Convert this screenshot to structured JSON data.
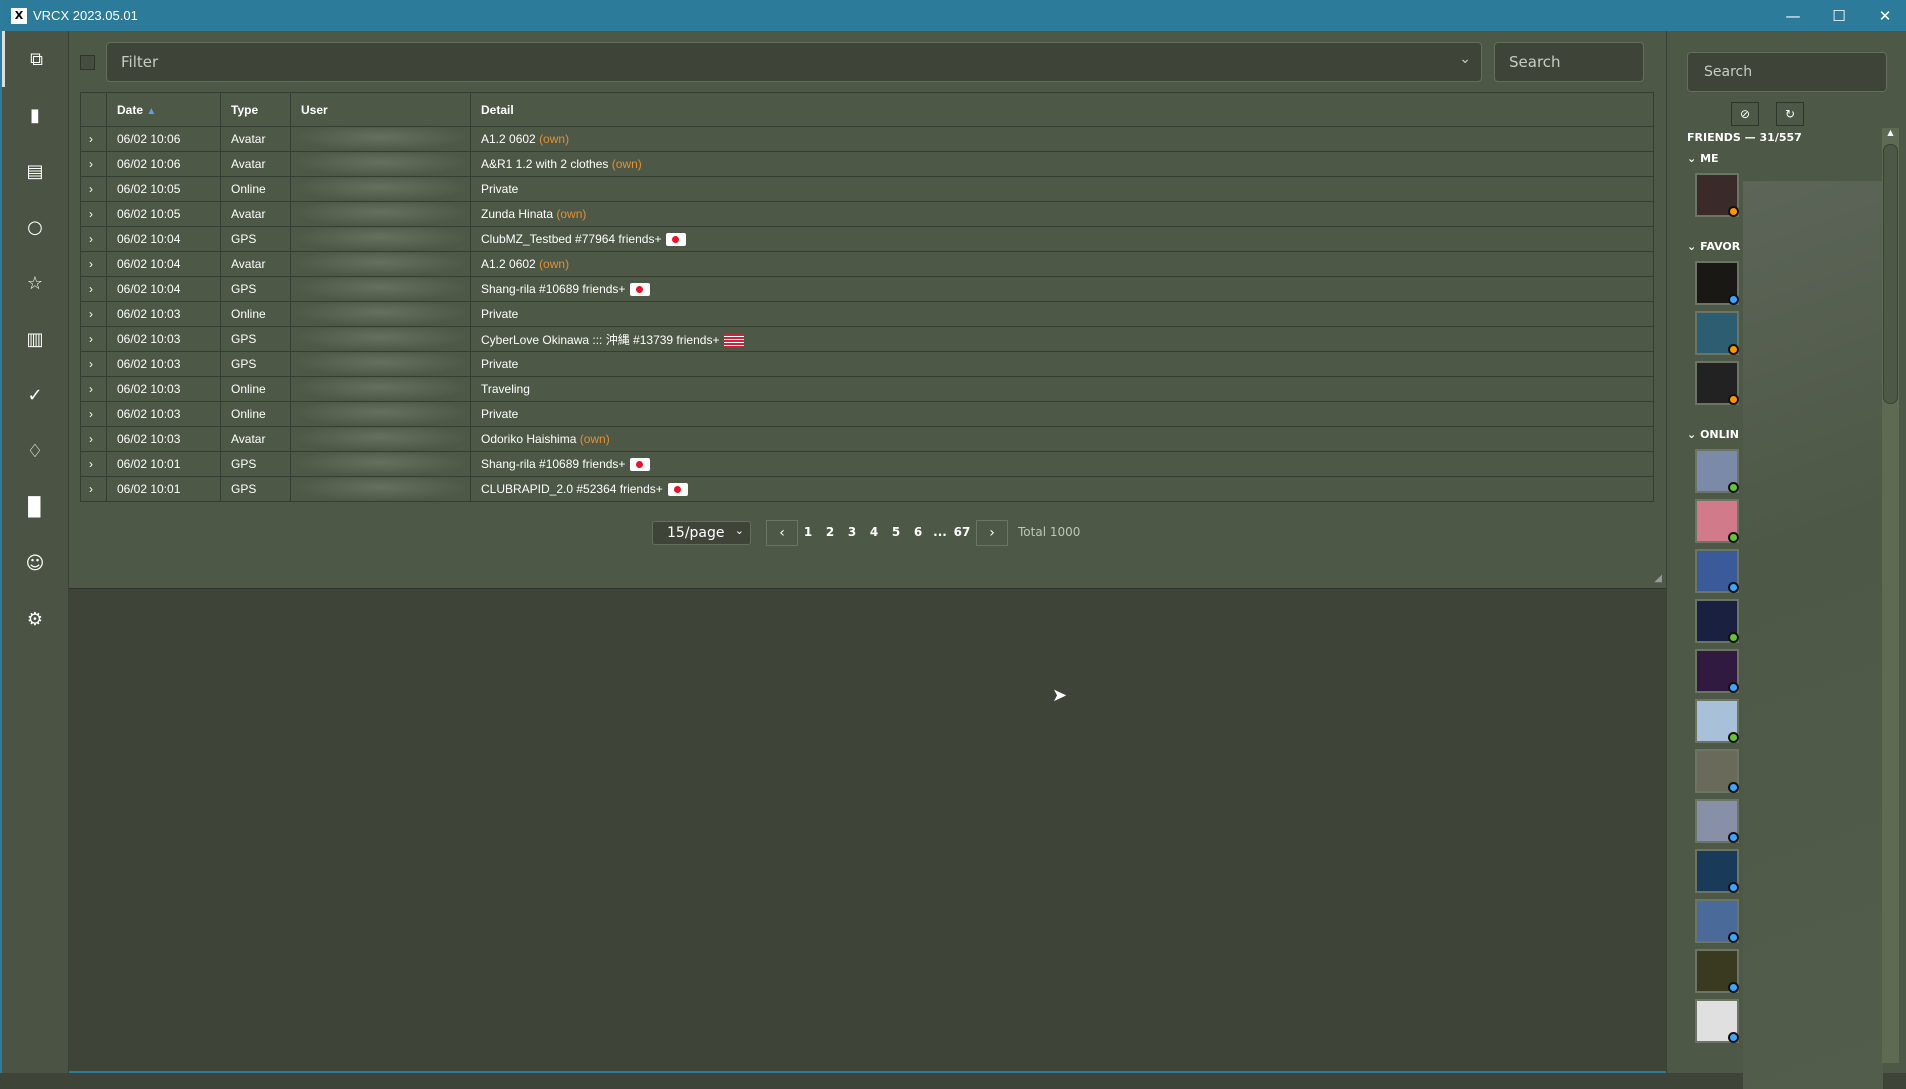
{
  "window": {
    "title": "VRCX 2023.05.01"
  },
  "nav": [
    "feed-icon",
    "chart-icon",
    "log-icon",
    "search-icon",
    "star-icon",
    "list-icon",
    "checklist-icon",
    "bell-icon",
    "book-icon",
    "user-icon",
    "gear-icon"
  ],
  "toolbar": {
    "filter_placeholder": "Filter",
    "search_placeholder": "Search"
  },
  "table": {
    "headers": [
      "Date",
      "Type",
      "User",
      "Detail"
    ],
    "rows": [
      {
        "date": "06/02 10:06",
        "type": "Avatar",
        "detail": "A1.2 0602",
        "tag": "(own)",
        "flag": ""
      },
      {
        "date": "06/02 10:06",
        "type": "Avatar",
        "detail": "A&R1 1.2 with 2 clothes",
        "tag": "(own)",
        "flag": ""
      },
      {
        "date": "06/02 10:05",
        "type": "Online",
        "detail": "Private",
        "tag": "",
        "flag": ""
      },
      {
        "date": "06/02 10:05",
        "type": "Avatar",
        "detail": "Zunda Hinata",
        "tag": "(own)",
        "flag": ""
      },
      {
        "date": "06/02 10:04",
        "type": "GPS",
        "detail": "ClubMZ_Testbed #77964 friends+",
        "tag": "",
        "flag": "jp"
      },
      {
        "date": "06/02 10:04",
        "type": "Avatar",
        "detail": "A1.2 0602",
        "tag": "(own)",
        "flag": ""
      },
      {
        "date": "06/02 10:04",
        "type": "GPS",
        "detail": "Shang-rila #10689 friends+",
        "tag": "",
        "flag": "jp"
      },
      {
        "date": "06/02 10:03",
        "type": "Online",
        "detail": "Private",
        "tag": "",
        "flag": ""
      },
      {
        "date": "06/02 10:03",
        "type": "GPS",
        "detail": "CyberLove Okinawa ::: 沖縄 #13739 friends+",
        "tag": "",
        "flag": "us"
      },
      {
        "date": "06/02 10:03",
        "type": "GPS",
        "detail": "Private",
        "tag": "",
        "flag": ""
      },
      {
        "date": "06/02 10:03",
        "type": "Online",
        "detail": "Traveling",
        "tag": "",
        "flag": ""
      },
      {
        "date": "06/02 10:03",
        "type": "Online",
        "detail": "Private",
        "tag": "",
        "flag": ""
      },
      {
        "date": "06/02 10:03",
        "type": "Avatar",
        "detail": "Odoriko Haishima",
        "tag": "(own)",
        "flag": ""
      },
      {
        "date": "06/02 10:01",
        "type": "GPS",
        "detail": "Shang-rila #10689 friends+",
        "tag": "",
        "flag": "jp"
      },
      {
        "date": "06/02 10:01",
        "type": "GPS",
        "detail": "CLUBRAPID_2.0 #52364 friends+",
        "tag": "",
        "flag": "jp"
      }
    ]
  },
  "pagination": {
    "page_size": "15/page",
    "pages": [
      "1",
      "2",
      "3",
      "4",
      "5",
      "6",
      "...",
      "67"
    ],
    "total": "Total 1000"
  },
  "friends": {
    "search_placeholder": "Search",
    "heading": "FRIENDS — 31/557",
    "groups": [
      {
        "label": "ME",
        "avatars": [
          {
            "status": "#ff9500",
            "color": "#3a2a2a"
          }
        ]
      },
      {
        "label": "FAVOR",
        "avatars": [
          {
            "status": "#3ea5ff",
            "color": "#1a1815"
          },
          {
            "status": "#ff9500",
            "color": "#2c5d70"
          },
          {
            "status": "#ff9500",
            "color": "#222"
          }
        ]
      },
      {
        "label": "ONLIN",
        "avatars": [
          {
            "status": "#67c23a",
            "color": "#7a8aa8"
          },
          {
            "status": "#67c23a",
            "color": "#d07a8a"
          },
          {
            "status": "#3ea5ff",
            "color": "#3a5a9a"
          },
          {
            "status": "#67c23a",
            "color": "#1a2040"
          },
          {
            "status": "#3ea5ff",
            "color": "#301a40"
          },
          {
            "status": "#67c23a",
            "color": "#a8c0d8"
          },
          {
            "status": "#3ea5ff",
            "color": "#6a6a5a"
          },
          {
            "status": "#3ea5ff",
            "color": "#8890a8"
          },
          {
            "status": "#3ea5ff",
            "color": "#1a3a5a"
          },
          {
            "status": "#3ea5ff",
            "color": "#4a6a9a"
          },
          {
            "status": "#3ea5ff",
            "color": "#3a3a20"
          },
          {
            "status": "#3ea5ff",
            "color": "#e0e0e0"
          }
        ]
      }
    ]
  },
  "colors": {
    "titlebar": "#2d7b9b",
    "panel": "#4e5846",
    "own": "#e0913a"
  }
}
